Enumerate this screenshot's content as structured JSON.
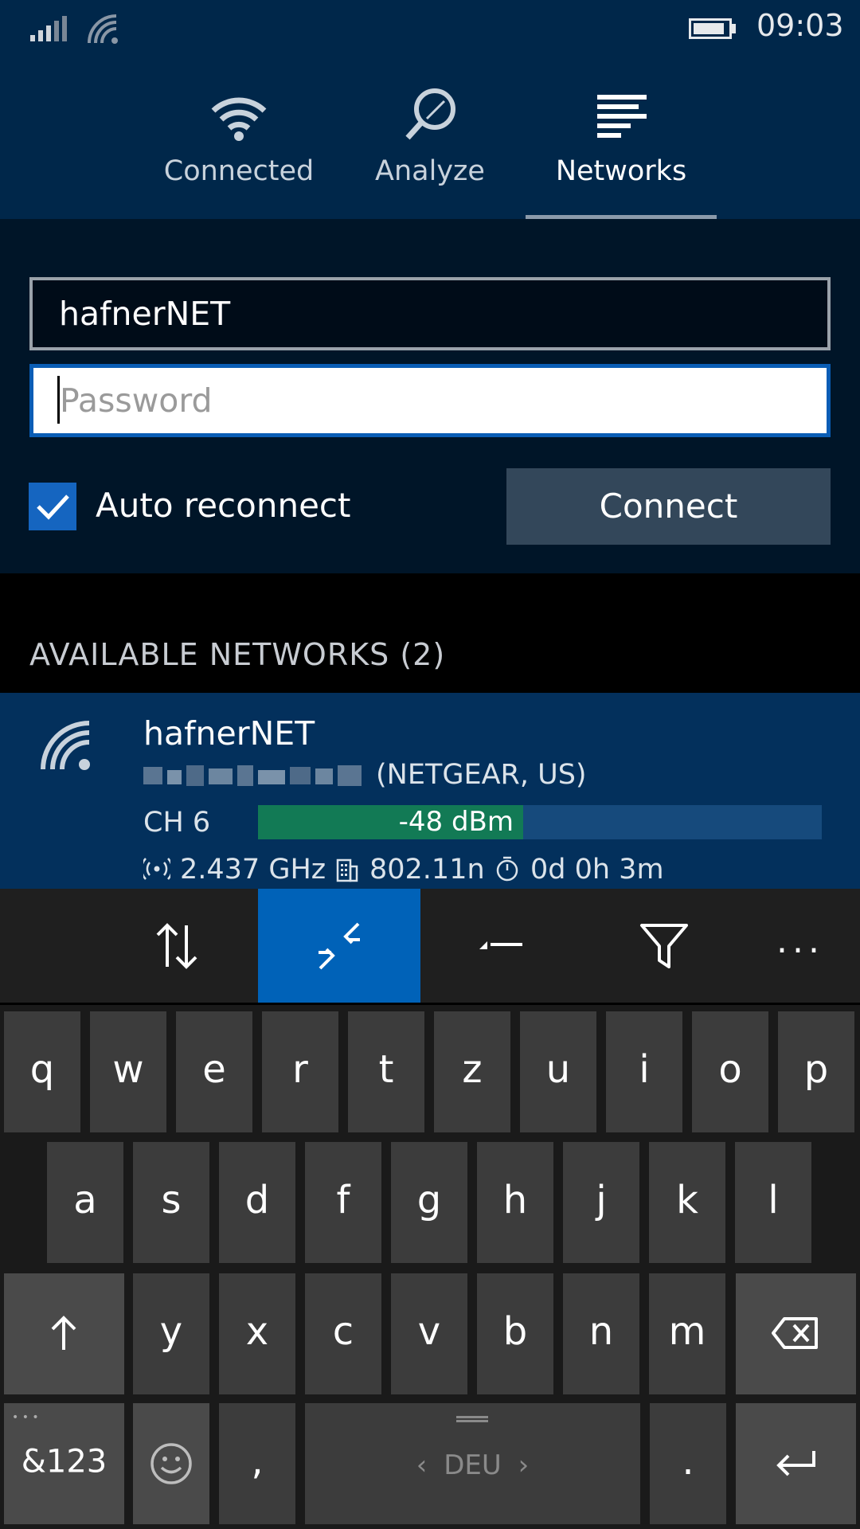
{
  "status_bar": {
    "time": "09:03"
  },
  "tabs": [
    {
      "label": "Connected",
      "icon": "wifi-icon"
    },
    {
      "label": "Analyze",
      "icon": "magnifier-icon"
    },
    {
      "label": "Networks",
      "icon": "list-icon",
      "active": true
    }
  ],
  "form": {
    "ssid_value": "hafnerNET",
    "password_placeholder": "Password",
    "auto_reconnect_label": "Auto reconnect",
    "auto_reconnect_checked": true,
    "connect_label": "Connect"
  },
  "networks": {
    "heading": "AVAILABLE NETWORKS (2)",
    "items": [
      {
        "name": "hafnerNET",
        "vendor": "(NETGEAR, US)",
        "channel": "CH 6",
        "signal": "-48 dBm",
        "signal_fraction": 0.47,
        "frequency": "2.437 GHz",
        "standard": "802.11n",
        "uptime": "0d 0h 3m"
      }
    ]
  },
  "app_bar": {
    "buttons": [
      "sort-icon",
      "connect-icon",
      "pin-icon",
      "filter-icon",
      "more-icon"
    ],
    "more_label": "..."
  },
  "keyboard": {
    "row1": [
      "q",
      "w",
      "e",
      "r",
      "t",
      "z",
      "u",
      "i",
      "o",
      "p"
    ],
    "row2": [
      "a",
      "s",
      "d",
      "f",
      "g",
      "h",
      "j",
      "k",
      "l"
    ],
    "row3": [
      "y",
      "x",
      "c",
      "v",
      "b",
      "n",
      "m"
    ],
    "symbols_label": "&123",
    "comma": ",",
    "period": ".",
    "language": "DEU",
    "lang_prev": "‹",
    "lang_next": "›",
    "dots": "• • •"
  },
  "colors": {
    "header_bg": "#00274a",
    "accent": "#0062b8",
    "signal_green": "#127a55"
  }
}
